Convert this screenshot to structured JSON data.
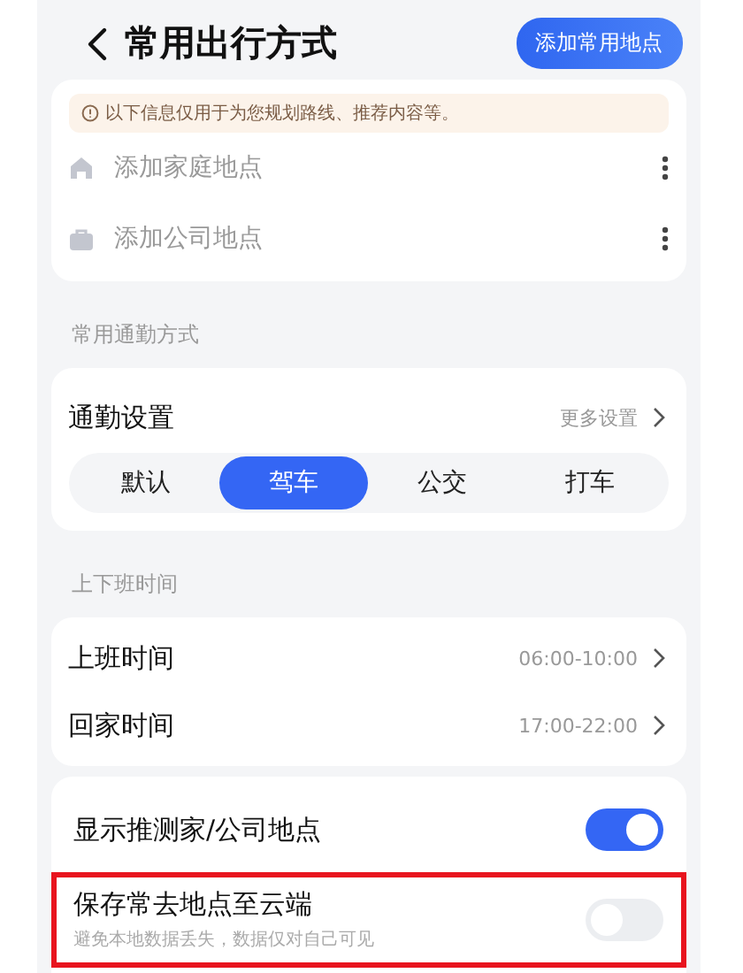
{
  "header": {
    "title": "常用出行方式",
    "action": "添加常用地点"
  },
  "notice": {
    "text": "以下信息仅用于为您规划路线、推荐内容等。"
  },
  "places": [
    {
      "kind": "home",
      "label": "添加家庭地点"
    },
    {
      "kind": "office",
      "label": "添加公司地点"
    }
  ],
  "commute": {
    "section": "常用通勤方式",
    "title": "通勤设置",
    "more": "更多设置",
    "modes": [
      {
        "label": "默认",
        "selected": false
      },
      {
        "label": "驾车",
        "selected": true
      },
      {
        "label": "公交",
        "selected": false
      },
      {
        "label": "打车",
        "selected": false
      }
    ]
  },
  "times": {
    "section": "上下班时间",
    "rows": [
      {
        "label": "上班时间",
        "value": "06:00-10:00"
      },
      {
        "label": "回家时间",
        "value": "17:00-22:00"
      }
    ]
  },
  "switches": [
    {
      "label": "显示推测家/公司地点",
      "on": true,
      "highlighted": false
    },
    {
      "label": "保存常去地点至云端",
      "subtitle": "避免本地数据丢失，数据仅对自己可见",
      "on": false,
      "highlighted": true
    }
  ]
}
